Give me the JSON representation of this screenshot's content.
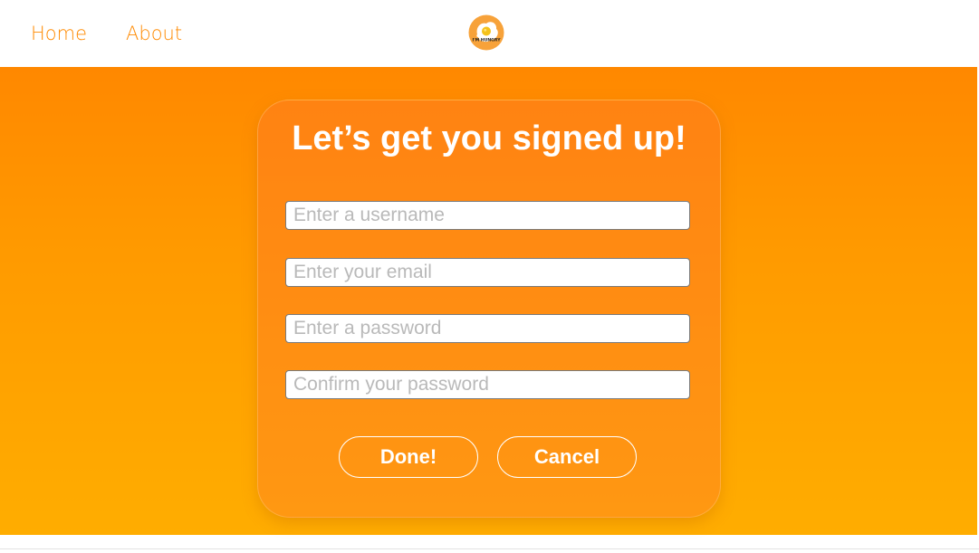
{
  "nav": {
    "home_label": "Home",
    "about_label": "About"
  },
  "logo": {
    "text": "I'M HUNGRY",
    "icon": "fried-egg-icon"
  },
  "signup": {
    "title": "Let’s get you signed up!",
    "username_placeholder": "Enter a username",
    "username_value": "",
    "email_placeholder": "Enter your email",
    "email_value": "",
    "password_placeholder": "Enter a password",
    "password_value": "",
    "confirm_placeholder": "Confirm your password",
    "confirm_value": "",
    "done_label": "Done!",
    "cancel_label": "Cancel"
  },
  "colors": {
    "accent": "#ff8a00",
    "gradient_top": "#ff8800",
    "gradient_bottom": "#ffad00",
    "button_text": "#ffffff"
  }
}
